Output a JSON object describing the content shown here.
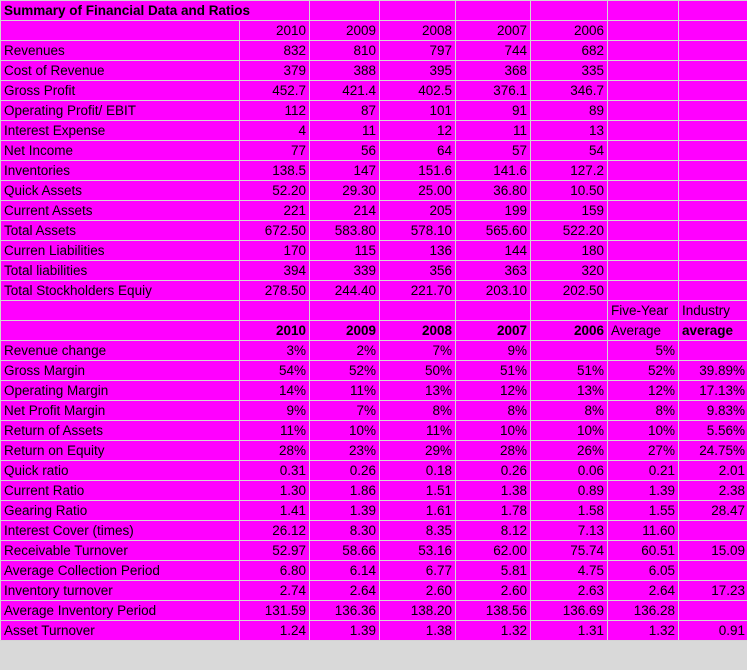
{
  "title": "Summary of Financial Data and Ratios",
  "columns": {
    "label": "",
    "years": [
      "2010",
      "2009",
      "2008",
      "2007",
      "2006"
    ],
    "five_year_line1": "Five-Year",
    "five_year_line2": "Average",
    "industry_line1": "Industry",
    "industry_line2": "average"
  },
  "colors": {
    "cell_background": "#ff00ff",
    "gridline": "#d4d4d4",
    "text": "#000000"
  },
  "financial_rows": [
    {
      "label": "Revenues",
      "values": [
        "832",
        "810",
        "797",
        "744",
        "682",
        "",
        ""
      ]
    },
    {
      "label": "Cost of Revenue",
      "values": [
        "379",
        "388",
        "395",
        "368",
        "335",
        "",
        ""
      ]
    },
    {
      "label": "Gross Profit",
      "values": [
        "452.7",
        "421.4",
        "402.5",
        "376.1",
        "346.7",
        "",
        ""
      ]
    },
    {
      "label": "Operating Profit/ EBIT",
      "values": [
        "112",
        "87",
        "101",
        "91",
        "89",
        "",
        ""
      ]
    },
    {
      "label": "Interest Expense",
      "values": [
        "4",
        "11",
        "12",
        "11",
        "13",
        "",
        ""
      ]
    },
    {
      "label": "Net Income",
      "values": [
        "77",
        "56",
        "64",
        "57",
        "54",
        "",
        ""
      ]
    },
    {
      "label": "Inventories",
      "values": [
        "138.5",
        "147",
        "151.6",
        "141.6",
        "127.2",
        "",
        ""
      ]
    },
    {
      "label": "Quick Assets",
      "values": [
        "52.20",
        "29.30",
        "25.00",
        "36.80",
        "10.50",
        "",
        ""
      ]
    },
    {
      "label": "Current Assets",
      "values": [
        "221",
        "214",
        "205",
        "199",
        "159",
        "",
        ""
      ]
    },
    {
      "label": "Total Assets",
      "values": [
        "672.50",
        "583.80",
        "578.10",
        "565.60",
        "522.20",
        "",
        ""
      ]
    },
    {
      "label": "Curren Liabilities",
      "values": [
        "170",
        "115",
        "136",
        "144",
        "180",
        "",
        ""
      ]
    },
    {
      "label": "Total liabilities",
      "values": [
        "394",
        "339",
        "356",
        "363",
        "320",
        "",
        ""
      ]
    },
    {
      "label": "Total Stockholders Equiy",
      "values": [
        "278.50",
        "244.40",
        "221.70",
        "203.10",
        "202.50",
        "",
        ""
      ]
    }
  ],
  "ratio_rows": [
    {
      "label": "Revenue change",
      "values": [
        "3%",
        "2%",
        "7%",
        "9%",
        "",
        "5%",
        ""
      ]
    },
    {
      "label": "Gross Margin",
      "values": [
        "54%",
        "52%",
        "50%",
        "51%",
        "51%",
        "52%",
        "39.89%"
      ]
    },
    {
      "label": "Operating Margin",
      "values": [
        "14%",
        "11%",
        "13%",
        "12%",
        "13%",
        "12%",
        "17.13%"
      ]
    },
    {
      "label": "Net Profit Margin",
      "values": [
        "9%",
        "7%",
        "8%",
        "8%",
        "8%",
        "8%",
        "9.83%"
      ]
    },
    {
      "label": "Return of Assets",
      "values": [
        "11%",
        "10%",
        "11%",
        "10%",
        "10%",
        "10%",
        "5.56%"
      ]
    },
    {
      "label": "Return on Equity",
      "values": [
        "28%",
        "23%",
        "29%",
        "28%",
        "26%",
        "27%",
        "24.75%"
      ]
    },
    {
      "label": "Quick ratio",
      "values": [
        "0.31",
        "0.26",
        "0.18",
        "0.26",
        "0.06",
        "0.21",
        "2.01"
      ]
    },
    {
      "label": "Current  Ratio",
      "values": [
        "1.30",
        "1.86",
        "1.51",
        "1.38",
        "0.89",
        "1.39",
        "2.38"
      ]
    },
    {
      "label": "Gearing Ratio",
      "values": [
        "1.41",
        "1.39",
        "1.61",
        "1.78",
        "1.58",
        "1.55",
        "28.47"
      ]
    },
    {
      "label": "Interest Cover (times)",
      "values": [
        "26.12",
        "8.30",
        "8.35",
        "8.12",
        "7.13",
        "11.60",
        ""
      ]
    },
    {
      "label": "Receivable Turnover",
      "values": [
        "52.97",
        "58.66",
        "53.16",
        "62.00",
        "75.74",
        "60.51",
        "15.09"
      ]
    },
    {
      "label": "Average Collection Period",
      "values": [
        "6.80",
        "6.14",
        "6.77",
        "5.81",
        "4.75",
        "6.05",
        ""
      ]
    },
    {
      "label": "Inventory turnover",
      "values": [
        "2.74",
        "2.64",
        "2.60",
        "2.60",
        "2.63",
        "2.64",
        "17.23"
      ]
    },
    {
      "label": "Average Inventory Period",
      "values": [
        "131.59",
        "136.36",
        "138.20",
        "138.56",
        "136.69",
        "136.28",
        ""
      ]
    },
    {
      "label": "Asset Turnover",
      "values": [
        "1.24",
        "1.39",
        "1.38",
        "1.32",
        "1.31",
        "1.32",
        "0.91"
      ]
    }
  ],
  "chart_data": {
    "type": "table",
    "title": "Summary of Financial Data and Ratios",
    "categories": [
      "2010",
      "2009",
      "2008",
      "2007",
      "2006"
    ],
    "series": [
      {
        "name": "Revenues",
        "values": [
          832,
          810,
          797,
          744,
          682
        ]
      },
      {
        "name": "Cost of Revenue",
        "values": [
          379,
          388,
          395,
          368,
          335
        ]
      },
      {
        "name": "Gross Profit",
        "values": [
          452.7,
          421.4,
          402.5,
          376.1,
          346.7
        ]
      },
      {
        "name": "Operating Profit/ EBIT",
        "values": [
          112,
          87,
          101,
          91,
          89
        ]
      },
      {
        "name": "Interest Expense",
        "values": [
          4,
          11,
          12,
          11,
          13
        ]
      },
      {
        "name": "Net Income",
        "values": [
          77,
          56,
          64,
          57,
          54
        ]
      },
      {
        "name": "Inventories",
        "values": [
          138.5,
          147,
          151.6,
          141.6,
          127.2
        ]
      },
      {
        "name": "Quick Assets",
        "values": [
          52.2,
          29.3,
          25.0,
          36.8,
          10.5
        ]
      },
      {
        "name": "Current Assets",
        "values": [
          221,
          214,
          205,
          199,
          159
        ]
      },
      {
        "name": "Total Assets",
        "values": [
          672.5,
          583.8,
          578.1,
          565.6,
          522.2
        ]
      },
      {
        "name": "Curren Liabilities",
        "values": [
          170,
          115,
          136,
          144,
          180
        ]
      },
      {
        "name": "Total liabilities",
        "values": [
          394,
          339,
          356,
          363,
          320
        ]
      },
      {
        "name": "Total Stockholders Equiy",
        "values": [
          278.5,
          244.4,
          221.7,
          203.1,
          202.5
        ]
      },
      {
        "name": "Revenue change",
        "values": [
          "3%",
          "2%",
          "7%",
          "9%",
          null
        ],
        "five_year_average": "5%",
        "industry_average": null
      },
      {
        "name": "Gross Margin",
        "values": [
          "54%",
          "52%",
          "50%",
          "51%",
          "51%"
        ],
        "five_year_average": "52%",
        "industry_average": "39.89%"
      },
      {
        "name": "Operating Margin",
        "values": [
          "14%",
          "11%",
          "13%",
          "12%",
          "13%"
        ],
        "five_year_average": "12%",
        "industry_average": "17.13%"
      },
      {
        "name": "Net Profit Margin",
        "values": [
          "9%",
          "7%",
          "8%",
          "8%",
          "8%"
        ],
        "five_year_average": "8%",
        "industry_average": "9.83%"
      },
      {
        "name": "Return of Assets",
        "values": [
          "11%",
          "10%",
          "11%",
          "10%",
          "10%"
        ],
        "five_year_average": "10%",
        "industry_average": "5.56%"
      },
      {
        "name": "Return on Equity",
        "values": [
          "28%",
          "23%",
          "29%",
          "28%",
          "26%"
        ],
        "five_year_average": "27%",
        "industry_average": "24.75%"
      },
      {
        "name": "Quick ratio",
        "values": [
          0.31,
          0.26,
          0.18,
          0.26,
          0.06
        ],
        "five_year_average": 0.21,
        "industry_average": 2.01
      },
      {
        "name": "Current  Ratio",
        "values": [
          1.3,
          1.86,
          1.51,
          1.38,
          0.89
        ],
        "five_year_average": 1.39,
        "industry_average": 2.38
      },
      {
        "name": "Gearing Ratio",
        "values": [
          1.41,
          1.39,
          1.61,
          1.78,
          1.58
        ],
        "five_year_average": 1.55,
        "industry_average": 28.47
      },
      {
        "name": "Interest Cover (times)",
        "values": [
          26.12,
          8.3,
          8.35,
          8.12,
          7.13
        ],
        "five_year_average": 11.6,
        "industry_average": null
      },
      {
        "name": "Receivable Turnover",
        "values": [
          52.97,
          58.66,
          53.16,
          62.0,
          75.74
        ],
        "five_year_average": 60.51,
        "industry_average": 15.09
      },
      {
        "name": "Average Collection Period",
        "values": [
          6.8,
          6.14,
          6.77,
          5.81,
          4.75
        ],
        "five_year_average": 6.05,
        "industry_average": null
      },
      {
        "name": "Inventory turnover",
        "values": [
          2.74,
          2.64,
          2.6,
          2.6,
          2.63
        ],
        "five_year_average": 2.64,
        "industry_average": 17.23
      },
      {
        "name": "Average Inventory Period",
        "values": [
          131.59,
          136.36,
          138.2,
          138.56,
          136.69
        ],
        "five_year_average": 136.28,
        "industry_average": null
      },
      {
        "name": "Asset Turnover",
        "values": [
          1.24,
          1.39,
          1.38,
          1.32,
          1.31
        ],
        "five_year_average": 1.32,
        "industry_average": 0.91
      }
    ],
    "xlabel": "",
    "ylabel": "",
    "grid": true,
    "legend": "none"
  }
}
